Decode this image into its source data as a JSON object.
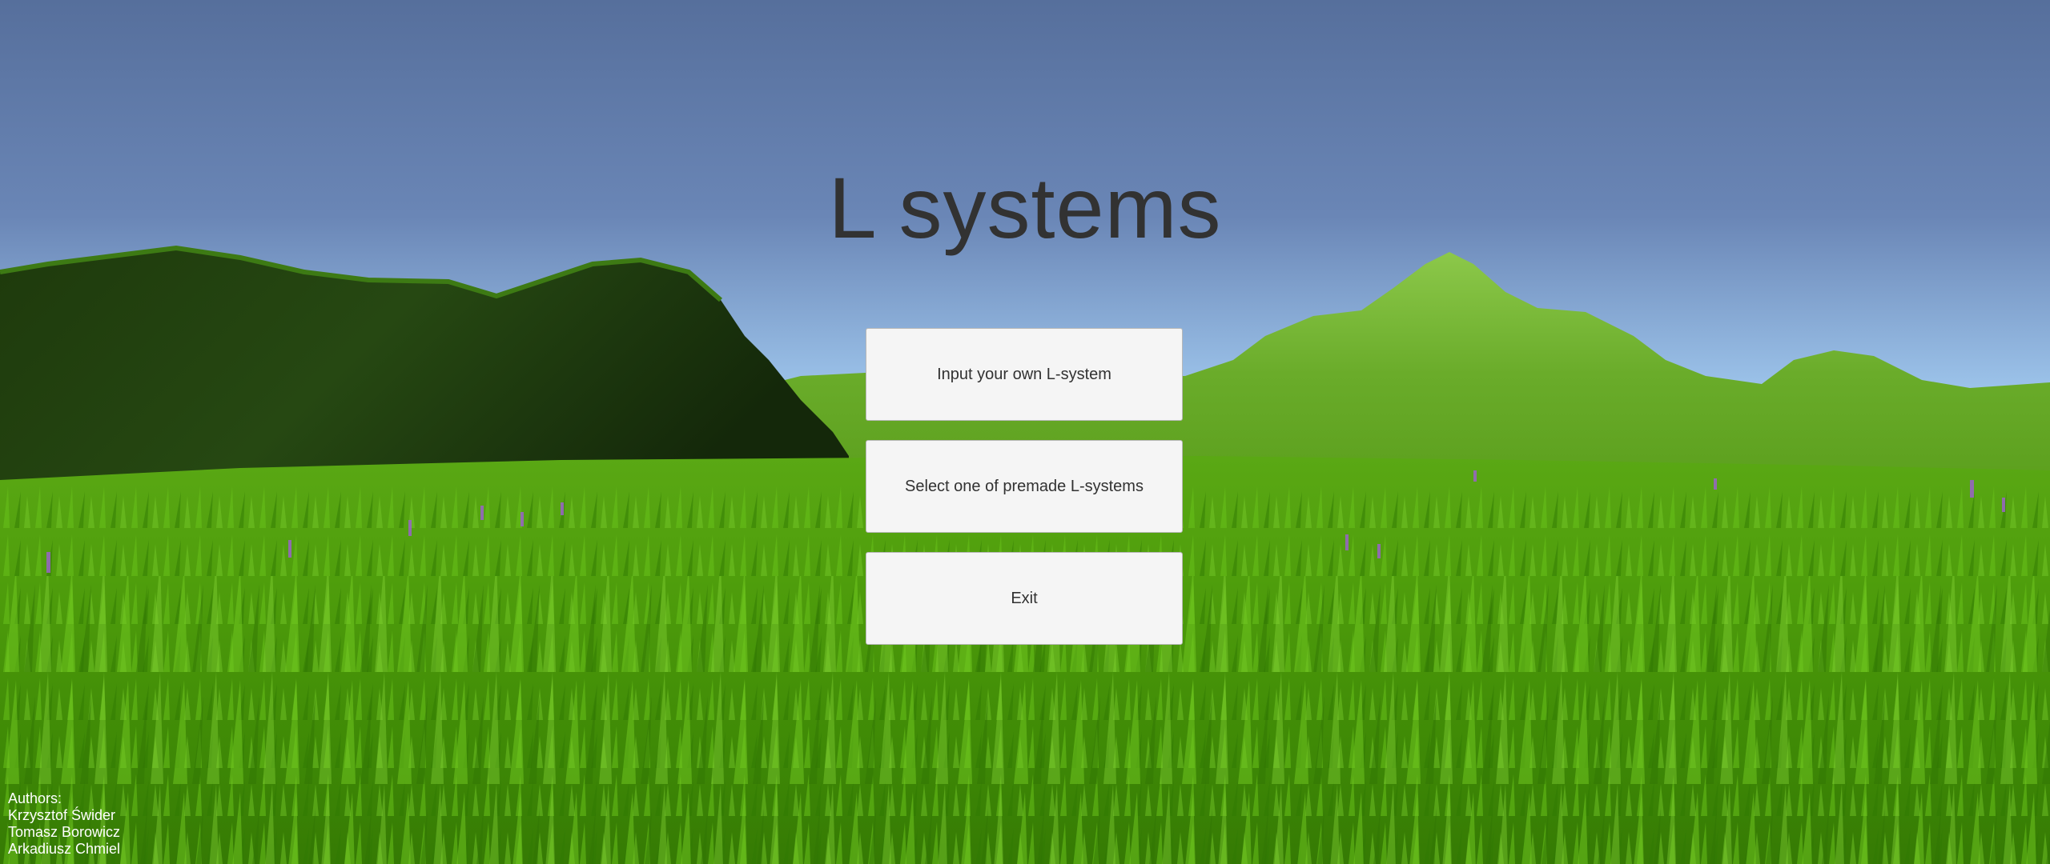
{
  "menu": {
    "title": "L systems",
    "buttons": [
      {
        "label": "Input your own L-system"
      },
      {
        "label": "Select one of premade L-systems"
      },
      {
        "label": "Exit"
      }
    ]
  },
  "credits": {
    "heading": "Authors:",
    "names": [
      "Krzysztof Świder",
      "Tomasz Borowicz",
      "Arkadiusz Chmiel"
    ]
  },
  "colors": {
    "sky_top": "#566f9c",
    "sky_horizon": "#9cc3ea",
    "grass": "#4ea20c",
    "button_bg": "#f5f5f5",
    "title_text": "#323232"
  }
}
